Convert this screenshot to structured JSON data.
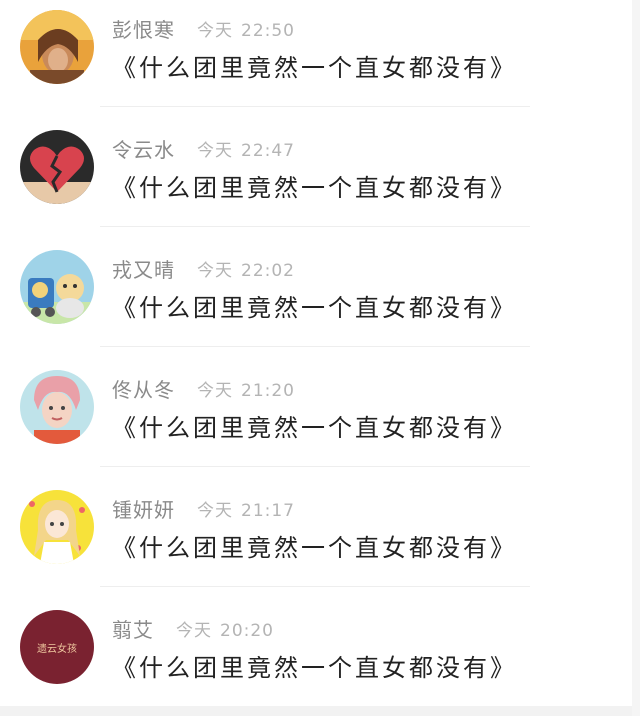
{
  "comments": [
    {
      "name": "彭恨寒",
      "day": "今天",
      "time": "22:50",
      "text": "《什么团里竟然一个直女都没有》",
      "avatar_icon": "portrait-avatar-icon"
    },
    {
      "name": "令云水",
      "day": "今天",
      "time": "22:47",
      "text": "《什么团里竟然一个直女都没有》",
      "avatar_icon": "broken-heart-avatar-icon"
    },
    {
      "name": "戎又晴",
      "day": "今天",
      "time": "22:02",
      "text": "《什么团里竟然一个直女都没有》",
      "avatar_icon": "cartoon-avatar-icon"
    },
    {
      "name": "佟从冬",
      "day": "今天",
      "time": "21:20",
      "text": "《什么团里竟然一个直女都没有》",
      "avatar_icon": "portrait-avatar-icon"
    },
    {
      "name": "锺妍妍",
      "day": "今天",
      "time": "21:17",
      "text": "《什么团里竟然一个直女都没有》",
      "avatar_icon": "anime-girl-avatar-icon"
    },
    {
      "name": "翦艾",
      "day": "今天",
      "time": "20:20",
      "text": "《什么团里竟然一个直女都没有》",
      "avatar_icon": "text-badge-avatar-icon",
      "avatar_text": "遗云女孩"
    }
  ]
}
